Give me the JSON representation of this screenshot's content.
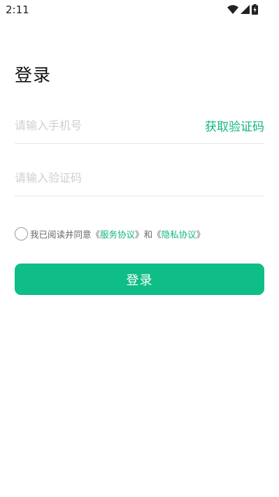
{
  "status_bar": {
    "time": "2:11",
    "icons": [
      "wifi-icon",
      "cellular-signal-icon",
      "battery-charging-icon"
    ]
  },
  "page": {
    "title": "登录"
  },
  "form": {
    "phone_placeholder": "请输入手机号",
    "phone_value": "",
    "get_code_label": "获取验证码",
    "code_placeholder": "请输入验证码",
    "code_value": ""
  },
  "agreement": {
    "checked": false,
    "prefix": "我已阅读并同意",
    "open_quote_1": "《",
    "service_link": "服务协议",
    "close_quote_1": "》",
    "conjunction": "和",
    "open_quote_2": "《",
    "privacy_link": "隐私协议",
    "close_quote_2": "》"
  },
  "login_button": {
    "label": "登录"
  },
  "colors": {
    "accent": "#13b57e",
    "button": "#0fbd86",
    "divider": "#e6e6e6",
    "placeholder": "#cfcfcf"
  }
}
